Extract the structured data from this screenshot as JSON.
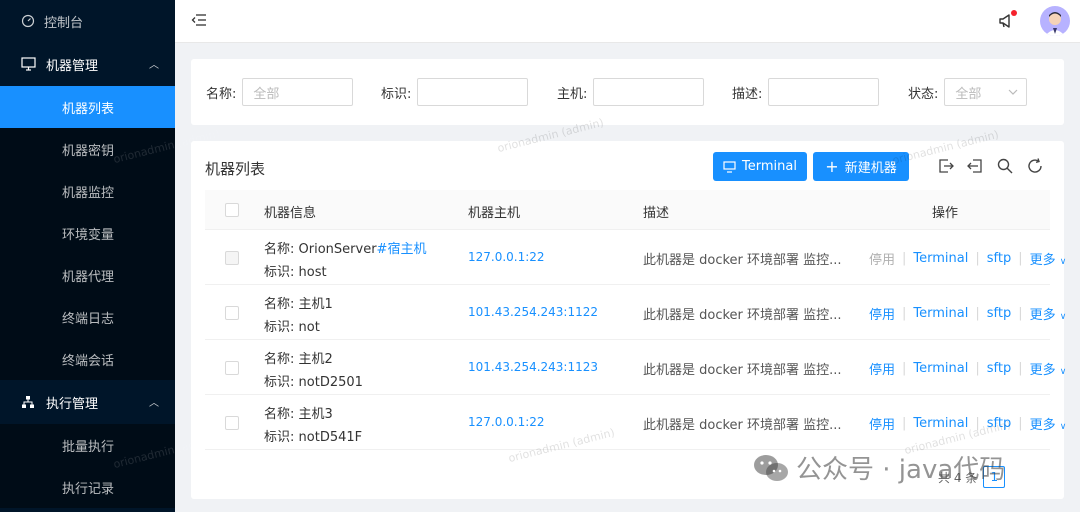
{
  "sidebar": {
    "console": "控制台",
    "group_machine": "机器管理",
    "machine_items": [
      "机器列表",
      "机器密钥",
      "机器监控",
      "环境变量",
      "机器代理",
      "终端日志",
      "终端会话"
    ],
    "group_exec": "执行管理",
    "exec_items": [
      "批量执行",
      "执行记录"
    ]
  },
  "search": {
    "name_label": "名称:",
    "name_placeholder": "全部",
    "tag_label": "标识:",
    "host_label": "主机:",
    "desc_label": "描述:",
    "status_label": "状态:",
    "status_value": "全部"
  },
  "table": {
    "title": "机器列表",
    "terminal_btn": "Terminal",
    "new_btn": "新建机器",
    "columns": [
      "机器信息",
      "机器主机",
      "描述",
      "操作"
    ],
    "rows": [
      {
        "name_label": "名称:",
        "name": "OrionServer",
        "tag_extra": "#宿主机",
        "id_label": "标识:",
        "id": "host",
        "host": "127.0.0.1:22",
        "desc": "此机器是 docker 环境部署 监控...",
        "op1": "停用",
        "op2": "Terminal",
        "op3": "sftp",
        "op4": "更多"
      },
      {
        "name_label": "名称:",
        "name": "主机1",
        "tag_extra": "",
        "id_label": "标识:",
        "id": "not",
        "host": "101.43.254.243:1122",
        "desc": "此机器是 docker 环境部署 监控...",
        "op1": "停用",
        "op2": "Terminal",
        "op3": "sftp",
        "op4": "更多"
      },
      {
        "name_label": "名称:",
        "name": "主机2",
        "tag_extra": "",
        "id_label": "标识:",
        "id": "notD2501",
        "host": "101.43.254.243:1123",
        "desc": "此机器是 docker 环境部署 监控...",
        "op1": "停用",
        "op2": "Terminal",
        "op3": "sftp",
        "op4": "更多"
      },
      {
        "name_label": "名称:",
        "name": "主机3",
        "tag_extra": "",
        "id_label": "标识:",
        "id": "notD541F",
        "host": "127.0.0.1:22",
        "desc": "此机器是 docker 环境部署 监控...",
        "op1": "停用",
        "op2": "Terminal",
        "op3": "sftp",
        "op4": "更多"
      }
    ],
    "total": "共 4 条",
    "page": "1"
  },
  "watermark": "orionadmin (admin)",
  "footer_watermark": "公众号 · java代码",
  "colors": {
    "primary": "#1890ff",
    "sidebar": "#001529",
    "active": "#1890ff"
  }
}
